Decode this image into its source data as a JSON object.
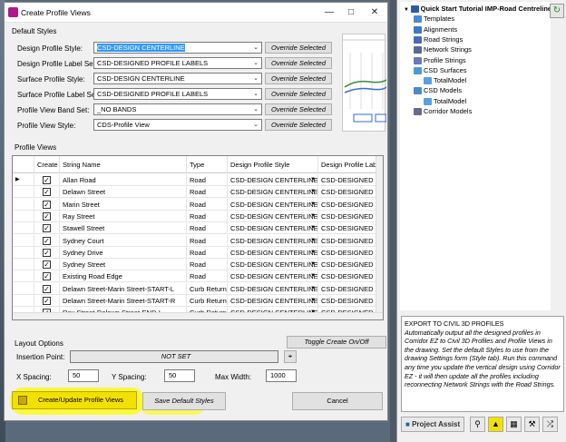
{
  "dialog": {
    "title": "Create Profile Views",
    "default_styles": {
      "group_label": "Default Styles",
      "rows": [
        {
          "label": "Design Profile Style:",
          "value": "CSD-DESIGN CENTERLINE",
          "button": "Override Selected"
        },
        {
          "label": "Design Profile Label Set:",
          "value": "CSD-DESIGNED PROFILE LABELS",
          "button": "Override Selected"
        },
        {
          "label": "Surface Profile Style:",
          "value": "CSD-DESIGN CENTERLINE",
          "button": "Override Selected"
        },
        {
          "label": "Surface Profile Label Set:",
          "value": "CSD-DESIGNED PROFILE LABELS",
          "button": "Override Selected"
        },
        {
          "label": "Profile View Band Set:",
          "value": "_NO BANDS",
          "button": "Override Selected"
        },
        {
          "label": "Profile View Style:",
          "value": "CDS-Profile View",
          "button": "Override Selected"
        }
      ]
    },
    "profile_views": {
      "group_label": "Profile Views",
      "columns": [
        "Create",
        "String Name",
        "Type",
        "Design Profile Style",
        "Design Profile Label"
      ],
      "rows": [
        {
          "name": "Allan Road",
          "type": "Road",
          "style": "CSD-DESIGN CENTERLINE",
          "label": "CSD-DESIGNED PRO"
        },
        {
          "name": "Delawn Street",
          "type": "Road",
          "style": "CSD-DESIGN CENTERLINE",
          "label": "CSD-DESIGNED PRO"
        },
        {
          "name": "Marin Street",
          "type": "Road",
          "style": "CSD-DESIGN CENTERLINE",
          "label": "CSD-DESIGNED PRO"
        },
        {
          "name": "Ray Street",
          "type": "Road",
          "style": "CSD-DESIGN CENTERLINE",
          "label": "CSD-DESIGNED PRO"
        },
        {
          "name": "Stawell Street",
          "type": "Road",
          "style": "CSD-DESIGN CENTERLINE",
          "label": "CSD-DESIGNED PRO"
        },
        {
          "name": "Sydney Court",
          "type": "Road",
          "style": "CSD-DESIGN CENTERLINE",
          "label": "CSD-DESIGNED PRO"
        },
        {
          "name": "Sydney Drive",
          "type": "Road",
          "style": "CSD-DESIGN CENTERLINE",
          "label": "CSD-DESIGNED PRO"
        },
        {
          "name": "Sydney Street",
          "type": "Road",
          "style": "CSD-DESIGN CENTERLINE",
          "label": "CSD-DESIGNED PRO"
        },
        {
          "name": "Existing Road Edge",
          "type": "Road",
          "style": "CSD-DESIGN CENTERLINE",
          "label": "CSD-DESIGNED PRO"
        },
        {
          "name": "Delawn Street-Marin Street-START-L",
          "type": "Curb Return",
          "style": "CSD-DESIGN CENTERLINE",
          "label": "CSD-DESIGNED PRO"
        },
        {
          "name": "Delawn Street-Marin Street-START-R",
          "type": "Curb Return",
          "style": "CSD-DESIGN CENTERLINE",
          "label": "CSD-DESIGNED PRO"
        },
        {
          "name": "Ray Street-Delawn Street-END-L",
          "type": "Curb Return",
          "style": "CSD-DESIGN CENTERLINE",
          "label": "CSD-DESIGNED PRO"
        }
      ]
    },
    "layout": {
      "group_label": "Layout Options",
      "toggle_button": "Toggle Create On/Off",
      "insertion_label": "Insertion Point:",
      "insertion_value": "NOT SET",
      "x_spacing_label": "X Spacing:",
      "x_spacing": "50",
      "y_spacing_label": "Y Spacing:",
      "y_spacing": "50",
      "max_width_label": "Max Width:",
      "max_width": "1000"
    },
    "buttons": {
      "create": "Create/Update Profile Views",
      "save_default": "Save Default Styles",
      "cancel": "Cancel"
    }
  },
  "panel": {
    "tree": [
      {
        "label": "Quick Start Tutorial IMP-Road Centreline",
        "indent": 0,
        "icon": "project-icon",
        "color": "#2a5aa8"
      },
      {
        "label": "Templates",
        "indent": 1,
        "icon": "folder-icon",
        "color": "#4a8ad8"
      },
      {
        "label": "Alignments",
        "indent": 1,
        "icon": "alignment-icon",
        "color": "#3a7ac8"
      },
      {
        "label": "Road Strings",
        "indent": 1,
        "icon": "road-icon",
        "color": "#4a6ab8"
      },
      {
        "label": "Network Strings",
        "indent": 1,
        "icon": "network-icon",
        "color": "#5a6a98"
      },
      {
        "label": "Profile Strings",
        "indent": 1,
        "icon": "profile-icon",
        "color": "#6a7ab8"
      },
      {
        "label": "CSD Surfaces",
        "indent": 1,
        "icon": "surface-icon",
        "color": "#4a9ad8"
      },
      {
        "label": "TotalModel",
        "indent": 2,
        "icon": "model-icon",
        "color": "#5aa0e0"
      },
      {
        "label": "CSD Models",
        "indent": 1,
        "icon": "models-icon",
        "color": "#4a8ac8"
      },
      {
        "label": "TotalModel",
        "indent": 2,
        "icon": "model-icon",
        "color": "#5aa0e0"
      },
      {
        "label": "Corridor Models",
        "indent": 1,
        "icon": "corridor-icon",
        "color": "#6a6a88"
      }
    ],
    "help_title": "EXPORT TO CIVIL 3D PROFILES",
    "help_body": "Automatically output all the designed profiles in Corridor EZ to Civil 3D Profiles and Profile Views in the drawing. Set the default Styles to use from the drawing Settings form (Style tab). Run this command any time you update the vertical design using Corridor EZ - it will then update all the profiles including reconnecting Network Strings with the Road Strings.",
    "project_assist": "Project Assist"
  },
  "colors": {
    "highlight": "#fff200",
    "selection": "#3399ff"
  }
}
